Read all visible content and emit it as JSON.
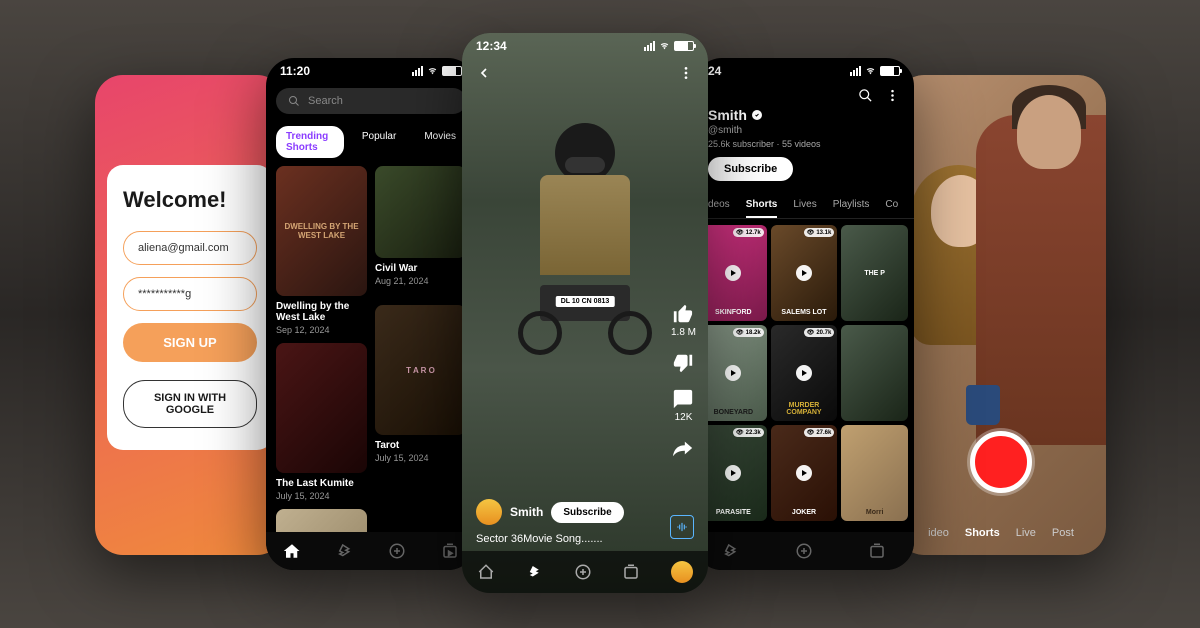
{
  "login": {
    "title": "Welcome!",
    "email": "aliena@gmail.com",
    "password": "***********g",
    "signup_label": "SIGN UP",
    "google_label": "SIGN IN WITH GOOGLE"
  },
  "browse": {
    "time": "11:20",
    "search_placeholder": "Search",
    "tabs": [
      "Trending Shorts",
      "Popular",
      "Movies"
    ],
    "items": [
      {
        "title": "Dwelling by the West Lake",
        "date": "Sep 12, 2024",
        "thumb_text": "DWELLING BY THE WEST LAKE"
      },
      {
        "title": "Civil War",
        "date": "Aug 21, 2024",
        "thumb_text": ""
      },
      {
        "title": "The Last Kumite",
        "date": "July 15, 2024",
        "thumb_text": ""
      },
      {
        "title": "Tarot",
        "date": "July 15, 2024",
        "thumb_text": "T A R O"
      }
    ]
  },
  "player": {
    "time": "12:34",
    "likes": "1.8 M",
    "comments": "12K",
    "plate": "DL 10 CN 0813",
    "user": "Smith",
    "subscribe_label": "Subscribe",
    "title": "Sector 36Movie Song......."
  },
  "profile": {
    "time": "24",
    "name": "Smith",
    "handle": "@smith",
    "stats": "25.6k subscriber  ·  55 videos",
    "subscribe_label": "Subscribe",
    "tabs": [
      "deos",
      "Shorts",
      "Lives",
      "Playlists",
      "Co"
    ],
    "videos": [
      {
        "views": "12.7k",
        "label": "SKINFORD"
      },
      {
        "views": "13.1k",
        "label": "SALEMS LOT"
      },
      {
        "views": "",
        "label": "THE P"
      },
      {
        "views": "18.2k",
        "label": "BONEYARD"
      },
      {
        "views": "20.7k",
        "label": "MURDER COMPANY"
      },
      {
        "views": "",
        "label": ""
      },
      {
        "views": "22.3k",
        "label": "PARASITE"
      },
      {
        "views": "27.6k",
        "label": "JOKER"
      },
      {
        "views": "",
        "label": "Morri"
      }
    ]
  },
  "camera": {
    "tabs": [
      "ideo",
      "Shorts",
      "Live",
      "Post"
    ]
  }
}
